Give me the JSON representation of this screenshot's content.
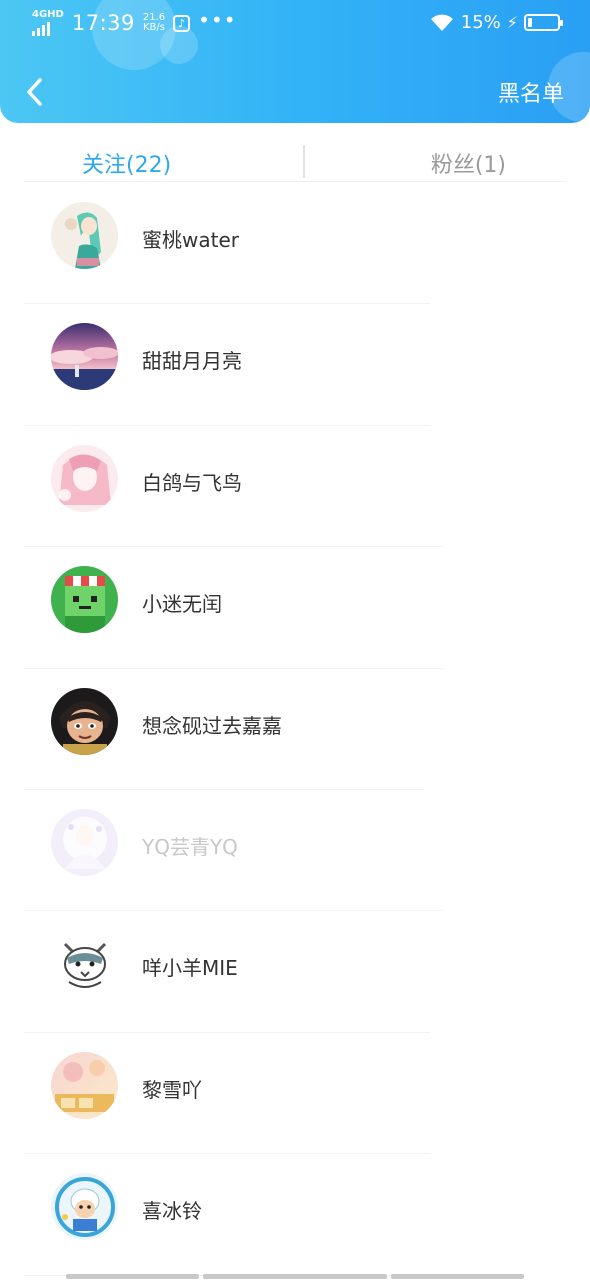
{
  "status_bar": {
    "network": "4GHD",
    "time": "17:39",
    "speed_value": "21.6",
    "speed_unit": "KB/s",
    "battery_percent": "15%",
    "battery_level": 0.15
  },
  "header": {
    "blacklist_label": "黑名单"
  },
  "tabs": {
    "following": "关注(22)",
    "followers": "粉丝(1)"
  },
  "colors": {
    "header_gradient": [
      "#4cc7f3",
      "#2a9ff4"
    ],
    "active_tab": "#2ea9ef",
    "inactive_tab": "#9a9a9a"
  },
  "users": [
    {
      "name": "蜜桃water",
      "avatar_icon": "anime-girl-green-hair-avatar"
    },
    {
      "name": "甜甜月月亮",
      "avatar_icon": "sunset-sky-scene-avatar"
    },
    {
      "name": "白鸽与飞鸟",
      "avatar_icon": "pink-anime-girl-avatar"
    },
    {
      "name": "小迷无闰",
      "avatar_icon": "green-block-character-avatar"
    },
    {
      "name": "想念砚过去嘉嘉",
      "avatar_icon": "cartoon-warrior-avatar"
    },
    {
      "name": "YQ芸青YQ",
      "avatar_icon": "white-fairy-avatar",
      "faded": true
    },
    {
      "name": "咩小羊MIE",
      "avatar_icon": "cartoon-sheep-avatar"
    },
    {
      "name": "黎雪吖",
      "avatar_icon": "peach-name-art-avatar"
    },
    {
      "name": "喜冰铃",
      "avatar_icon": "cartoon-goat-avatar"
    }
  ]
}
